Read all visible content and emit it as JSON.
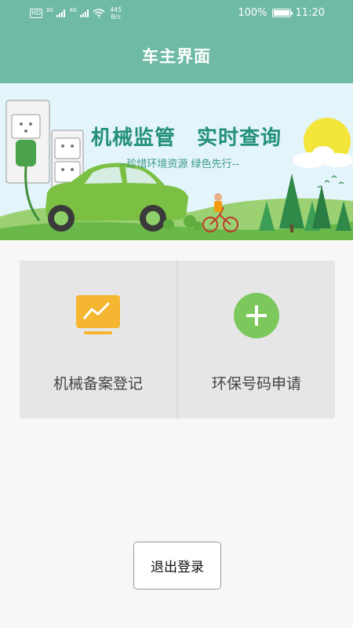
{
  "status_bar": {
    "hd": "HD",
    "net1": "3G",
    "net2": "4G",
    "speed_value": "445",
    "speed_unit": "B/s",
    "battery": "100%",
    "battery_level": 1.0,
    "time": "11:20"
  },
  "header": {
    "title": "车主界面"
  },
  "banner": {
    "headline": "机械监管　实时查询",
    "slogan": "--珍惜环境资源 绿色先行--"
  },
  "menu": {
    "items": [
      {
        "label": "机械备案登记",
        "icon": "chart-board-icon",
        "icon_color": "#f5b731"
      },
      {
        "label": "环保号码申请",
        "icon": "plus-circle-icon",
        "icon_color": "#7cc85c"
      }
    ]
  },
  "actions": {
    "logout_label": "退出登录"
  },
  "colors": {
    "header": "#6fbaa5",
    "accent_green": "#23907a",
    "tile_bg": "#e6e6e6"
  }
}
